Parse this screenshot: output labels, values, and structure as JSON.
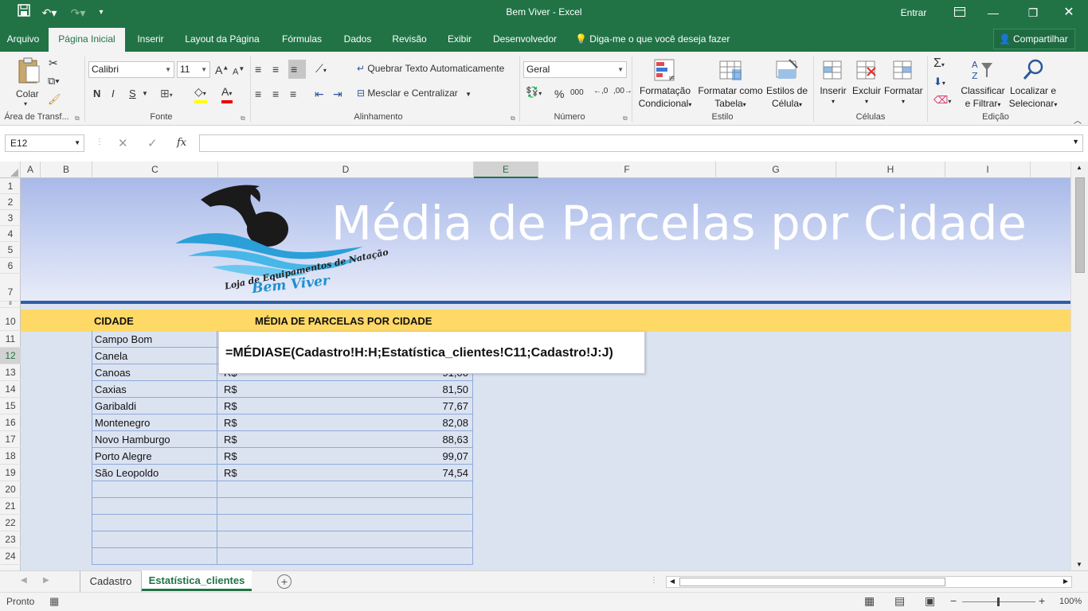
{
  "window": {
    "title": "Bem Viver  -  Excel",
    "signin": "Entrar"
  },
  "ribbon_tabs": [
    {
      "label": "Arquivo"
    },
    {
      "label": "Página Inicial"
    },
    {
      "label": "Inserir"
    },
    {
      "label": "Layout da Página"
    },
    {
      "label": "Fórmulas"
    },
    {
      "label": "Dados"
    },
    {
      "label": "Revisão"
    },
    {
      "label": "Exibir"
    },
    {
      "label": "Desenvolvedor"
    }
  ],
  "tell_me": "Diga-me o que você deseja fazer",
  "share": "Compartilhar",
  "ribbon": {
    "clipboard": {
      "paste": "Colar",
      "group": "Área de Transf..."
    },
    "font": {
      "name": "Calibri",
      "size": "11",
      "bold": "N",
      "italic": "I",
      "underline": "S",
      "group": "Fonte"
    },
    "alignment": {
      "wrap": "Quebrar Texto Automaticamente",
      "merge": "Mesclar e Centralizar",
      "group": "Alinhamento"
    },
    "number": {
      "format": "Geral",
      "percent": "%",
      "thousands": "000",
      "group": "Número"
    },
    "styles": {
      "conditional_1": "Formatação",
      "conditional_2": "Condicional",
      "table_1": "Formatar como",
      "table_2": "Tabela",
      "cell_1": "Estilos de",
      "cell_2": "Célula",
      "group": "Estilo"
    },
    "cells": {
      "insert": "Inserir",
      "delete": "Excluir",
      "format": "Formatar",
      "group": "Células"
    },
    "editing": {
      "sort_1": "Classificar",
      "sort_2": "e Filtrar",
      "find_1": "Localizar e",
      "find_2": "Selecionar",
      "group": "Edição"
    }
  },
  "formula_bar": {
    "name_box": "E12",
    "fx": "fx",
    "content": ""
  },
  "columns": [
    "A",
    "B",
    "C",
    "D",
    "E",
    "F",
    "G",
    "H",
    "I"
  ],
  "rows": [
    "1",
    "2",
    "3",
    "4",
    "5",
    "6",
    "7",
    "10",
    "11",
    "12",
    "13",
    "14",
    "15",
    "16",
    "17",
    "18",
    "19",
    "20",
    "21",
    "22",
    "23",
    "24"
  ],
  "banner": {
    "title": "Média de Parcelas por Cidade",
    "logo_line1": "Loja de Equipamentos de Natação",
    "logo_line2": "Bem Viver"
  },
  "table": {
    "header_city": "CIDADE",
    "header_avg": "MÉDIA DE PARCELAS POR CIDADE",
    "rows": [
      {
        "city": "Campo Bom",
        "currency": "",
        "value": ""
      },
      {
        "city": "Canela",
        "currency": "",
        "value": ""
      },
      {
        "city": "Canoas",
        "currency": "R$",
        "value": "91,00"
      },
      {
        "city": "Caxias",
        "currency": "R$",
        "value": "81,50"
      },
      {
        "city": "Garibaldi",
        "currency": "R$",
        "value": "77,67"
      },
      {
        "city": "Montenegro",
        "currency": "R$",
        "value": "82,08"
      },
      {
        "city": "Novo Hamburgo",
        "currency": "R$",
        "value": "88,63"
      },
      {
        "city": "Porto Alegre",
        "currency": "R$",
        "value": "99,07"
      },
      {
        "city": "São Leopoldo",
        "currency": "R$",
        "value": "74,54"
      }
    ]
  },
  "tooltip_formula": "=MÉDIASE(Cadastro!H:H;Estatística_clientes!C11;Cadastro!J:J)",
  "sheets": [
    {
      "label": "Cadastro"
    },
    {
      "label": "Estatística_clientes"
    }
  ],
  "status": {
    "ready": "Pronto",
    "zoom": "100%"
  },
  "colors": {
    "accent": "#217346",
    "banner_line": "#2e5fa8",
    "header_fill": "#ffd966",
    "sheet_fill": "#dbe3f1"
  }
}
